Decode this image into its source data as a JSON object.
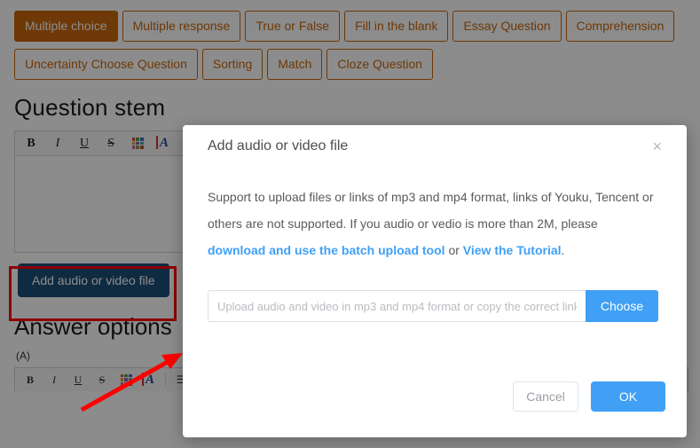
{
  "page": {
    "tab_rows": [
      [
        {
          "label": "Multiple choice",
          "active": true
        },
        {
          "label": "Multiple response",
          "active": false
        },
        {
          "label": "True or False",
          "active": false
        },
        {
          "label": "Fill in the blank",
          "active": false
        },
        {
          "label": "Essay Question",
          "active": false
        },
        {
          "label": "Comprehension",
          "active": false
        }
      ],
      [
        {
          "label": "Uncertainty Choose Question",
          "active": false
        },
        {
          "label": "Sorting",
          "active": false
        },
        {
          "label": "Match",
          "active": false
        },
        {
          "label": "Cloze Question",
          "active": false
        }
      ]
    ],
    "question_stem_title": "Question stem",
    "answer_options_title": "Answer options",
    "option_a_label": "(A)",
    "add_av_button": "Add audio or video file",
    "toolbar_icons": [
      {
        "name": "bold-icon",
        "glyph": "B"
      },
      {
        "name": "italic-icon",
        "glyph": "I"
      },
      {
        "name": "underline-icon",
        "glyph": "U"
      },
      {
        "name": "strikethrough-icon",
        "glyph": "S"
      },
      {
        "name": "background-color-palette-icon",
        "glyph": ""
      },
      {
        "name": "font-color-icon",
        "glyph": "A"
      }
    ]
  },
  "modal": {
    "title": "Add audio or video file",
    "close_label": "×",
    "description_part1": "Support to upload files or links of mp3 and mp4 format, links of Youku, Tencent or others are not supported. If you audio or vedio is more than 2M, please ",
    "link_batch_tool": "download and use the batch upload tool",
    "description_part2": " or ",
    "link_tutorial": "View the Tutorial",
    "description_part3": ".",
    "input_value": "",
    "input_placeholder": "Upload audio and video in mp3 and mp4 format or copy the correct link",
    "choose_button": "Choose",
    "cancel_button": "Cancel",
    "ok_button": "OK"
  },
  "annotations": {
    "highlight_color": "#ff0000",
    "arrow_color": "#ff0000"
  },
  "colors": {
    "tab_accent": "#c8670d",
    "primary_blue": "#3fa0f5",
    "add_button_blue": "#1d4f78",
    "overlay": "rgba(0,0,0,0.45)"
  }
}
